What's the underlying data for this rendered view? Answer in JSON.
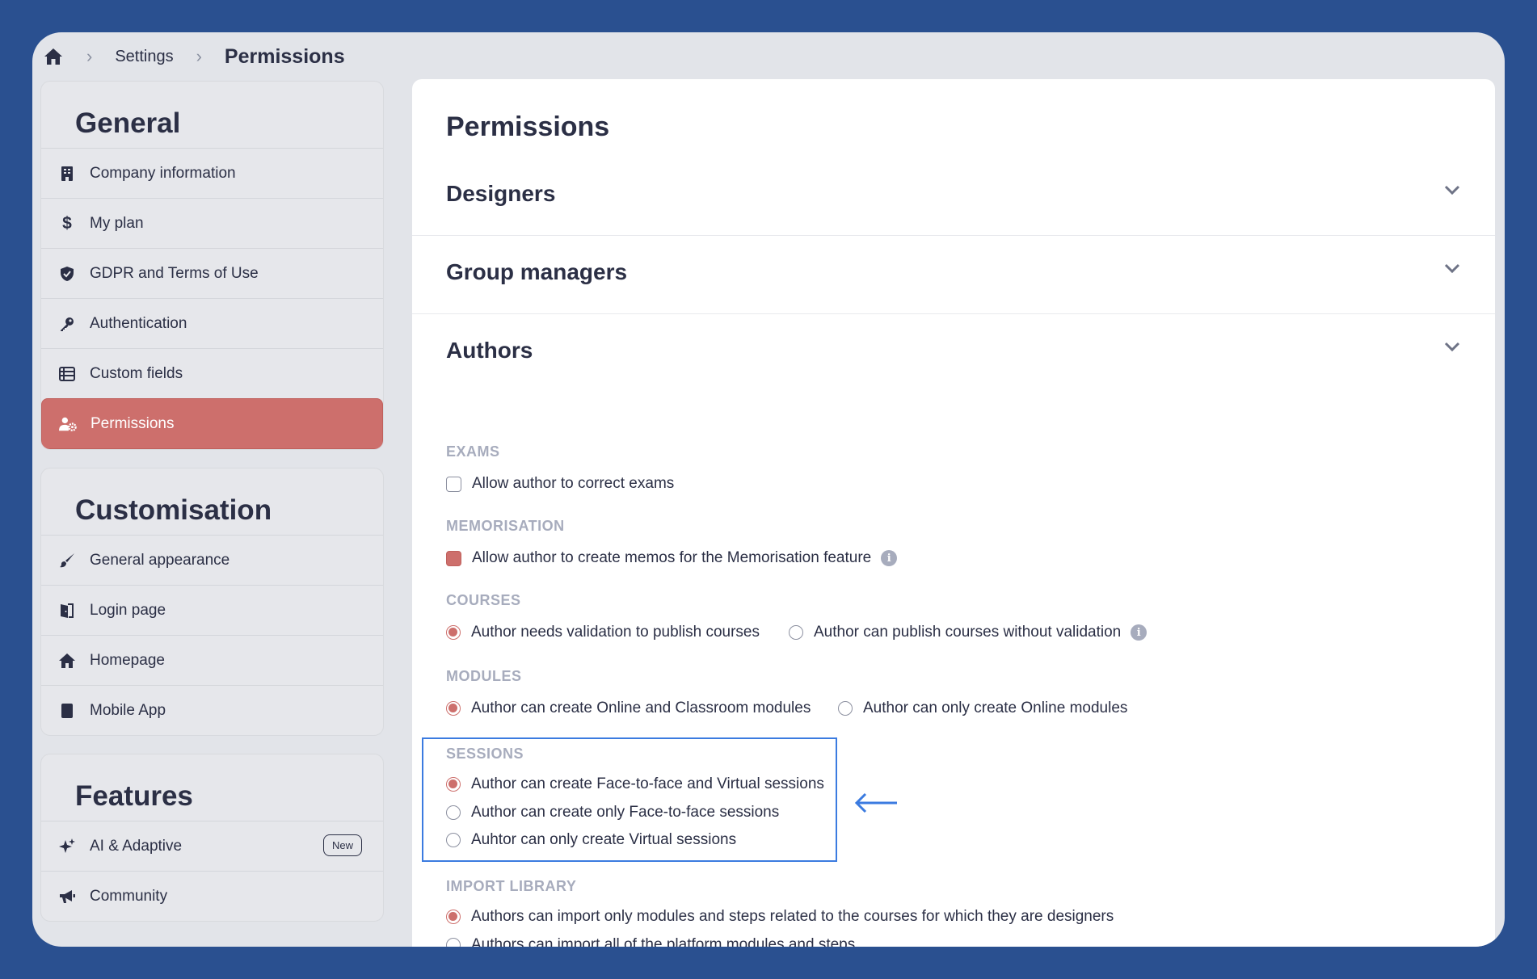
{
  "breadcrumb": {
    "settings": "Settings",
    "current": "Permissions"
  },
  "sidebar": {
    "general": {
      "title": "General",
      "items": [
        {
          "label": "Company information",
          "icon": "building-icon"
        },
        {
          "label": "My plan",
          "icon": "dollar-icon"
        },
        {
          "label": "GDPR and Terms of Use",
          "icon": "shield-icon"
        },
        {
          "label": "Authentication",
          "icon": "key-icon"
        },
        {
          "label": "Custom fields",
          "icon": "table-icon"
        },
        {
          "label": "Permissions",
          "icon": "user-gear-icon",
          "active": true
        }
      ]
    },
    "customisation": {
      "title": "Customisation",
      "items": [
        {
          "label": "General appearance",
          "icon": "brush-icon"
        },
        {
          "label": "Login page",
          "icon": "door-icon"
        },
        {
          "label": "Homepage",
          "icon": "home-icon"
        },
        {
          "label": "Mobile App",
          "icon": "phone-icon"
        }
      ]
    },
    "features": {
      "title": "Features",
      "items": [
        {
          "label": "AI & Adaptive",
          "icon": "sparkle-icon",
          "badge": "New"
        },
        {
          "label": "Community",
          "icon": "megaphone-icon"
        }
      ]
    }
  },
  "main": {
    "title": "Permissions",
    "accordions": [
      "Designers",
      "Group managers",
      "Authors"
    ],
    "sections": {
      "exams": {
        "label": "EXAMS",
        "option": "Allow author to correct exams",
        "checked": false
      },
      "memorisation": {
        "label": "MEMORISATION",
        "option": "Allow author to create memos for the Memorisation feature",
        "checked": true
      },
      "courses": {
        "label": "COURSES",
        "options": [
          "Author needs validation to publish courses",
          "Author can publish courses without validation"
        ],
        "selected": 0
      },
      "modules": {
        "label": "MODULES",
        "options": [
          "Author can create Online and Classroom modules",
          "Author can only create Online modules"
        ],
        "selected": 0
      },
      "sessions": {
        "label": "SESSIONS",
        "options": [
          "Author can create Face-to-face and Virtual sessions",
          "Author can create only Face-to-face sessions",
          "Auhtor can only create Virtual sessions"
        ],
        "selected": 0
      },
      "import_library": {
        "label": "IMPORT LIBRARY",
        "options": [
          "Authors can import only modules and steps related to the courses for which they are designers",
          "Authors can import all of the platform modules and steps"
        ],
        "selected": 0
      }
    }
  },
  "colors": {
    "accent": "#cd6f6c",
    "highlight": "#3b7be0",
    "background": "#2a5090"
  }
}
